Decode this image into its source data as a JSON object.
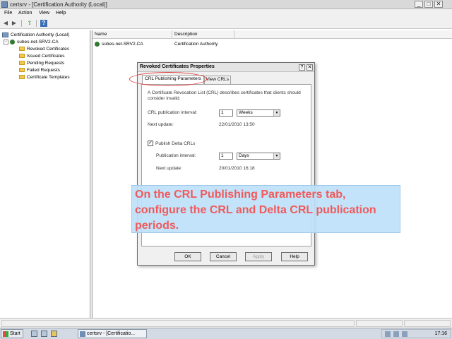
{
  "window": {
    "title": "certsrv - [Certification Authority (Local)]",
    "min": "_",
    "max": "□",
    "close": "✕"
  },
  "menubar": {
    "items": [
      "File",
      "Action",
      "View",
      "Help"
    ]
  },
  "toolbar": {
    "back": "◀",
    "forward": "▶",
    "up": "⇧",
    "help": "?"
  },
  "tree": {
    "root": "Certification Authority (Local)",
    "ca": "subes-net-SRV2-CA",
    "expander": "-",
    "folders": [
      "Revoked Certificates",
      "Issued Certificates",
      "Pending Requests",
      "Failed Requests",
      "Certificate Templates"
    ]
  },
  "list": {
    "columns": [
      "Name",
      "Description"
    ],
    "rows": [
      {
        "name": "subes-net-SRV2-CA",
        "description": "Certification Authority"
      }
    ]
  },
  "dialog": {
    "title": "Revoked Certificates Properties",
    "help_btn": "?",
    "close_btn": "✕",
    "tabs": [
      "CRL Publishing Parameters",
      "View CRLs"
    ],
    "description": "A Certificate Revocation List (CRL) describes certificates that clients should consider invalid.",
    "crl_interval_label": "CRL publication interval:",
    "crl_interval_value": "1",
    "crl_interval_unit": "Weeks",
    "next_update_label": "Next update:",
    "next_update_value": "22/01/2010 13:50",
    "publish_delta_label": "Publish Delta CRLs",
    "publish_delta_checked": "✓",
    "delta_interval_label": "Publication interval:",
    "delta_interval_value": "1",
    "delta_interval_unit": "Days",
    "delta_next_update_label": "Next update:",
    "delta_next_update_value": "20/01/2010 16:18",
    "buttons": [
      "OK",
      "Cancel",
      "Apply",
      "Help"
    ]
  },
  "callout": {
    "text": "On the CRL Publishing Parameters tab, configure the CRL and Delta CRL publication periods."
  },
  "taskbar": {
    "start": "Start",
    "task_label": "certsrv - [Certificatio...",
    "clock": "17:16"
  },
  "colors": {
    "callout_text": "#f05a5a",
    "callout_bg": "#bee1fa",
    "highlight": "#e04040"
  }
}
